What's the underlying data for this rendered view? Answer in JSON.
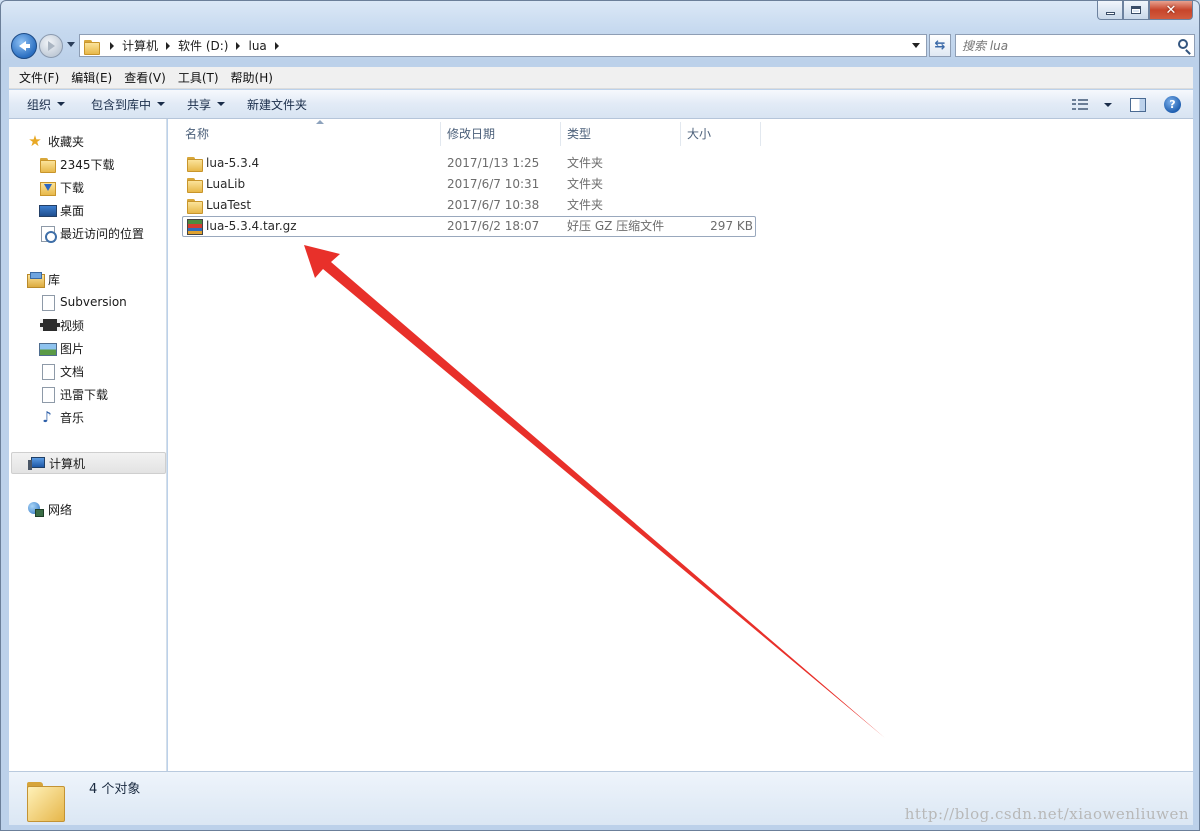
{
  "address": {
    "breadcrumbs": [
      "计算机",
      "软件 (D:)",
      "lua"
    ],
    "search_placeholder": "搜索 lua"
  },
  "menubar": [
    "文件(F)",
    "编辑(E)",
    "查看(V)",
    "工具(T)",
    "帮助(H)"
  ],
  "commands": {
    "organize": "组织",
    "include_library": "包含到库中",
    "share": "共享",
    "new_folder": "新建文件夹"
  },
  "nav": {
    "favorites": {
      "label": "收藏夹",
      "items": [
        "2345下载",
        "下载",
        "桌面",
        "最近访问的位置"
      ]
    },
    "libraries": {
      "label": "库",
      "items": [
        "Subversion",
        "视频",
        "图片",
        "文档",
        "迅雷下载",
        "音乐"
      ]
    },
    "computer": "计算机",
    "network": "网络"
  },
  "columns": {
    "name": "名称",
    "modified": "修改日期",
    "type": "类型",
    "size": "大小"
  },
  "files": [
    {
      "name": "lua-5.3.4",
      "modified": "2017/1/13 1:25",
      "type": "文件夹",
      "size": "",
      "icon": "folder-icon"
    },
    {
      "name": "LuaLib",
      "modified": "2017/6/7 10:31",
      "type": "文件夹",
      "size": "",
      "icon": "folder-icon"
    },
    {
      "name": "LuaTest",
      "modified": "2017/6/7 10:38",
      "type": "文件夹",
      "size": "",
      "icon": "folder-icon"
    },
    {
      "name": "lua-5.3.4.tar.gz",
      "modified": "2017/6/2 18:07",
      "type": "好压 GZ 压缩文件",
      "size": "297 KB",
      "icon": "archive-icon"
    }
  ],
  "status": {
    "count": "4 个对象"
  },
  "watermark": "http://blog.csdn.net/xiaowenliuwen",
  "colors": {
    "annotation_arrow": "#e8302a"
  }
}
